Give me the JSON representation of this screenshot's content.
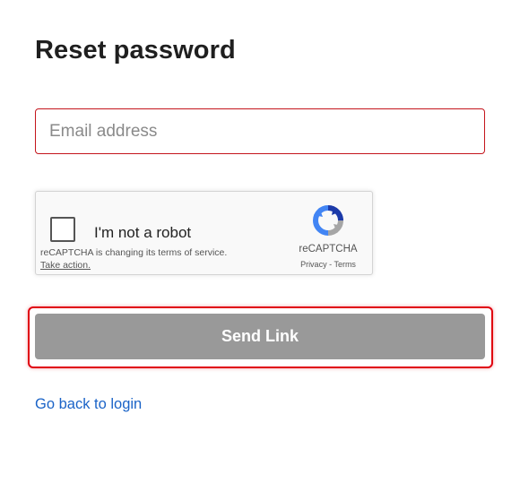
{
  "page": {
    "title": "Reset password"
  },
  "form": {
    "email_placeholder": "Email address",
    "email_value": "",
    "send_label": "Send Link",
    "back_link": "Go back to login"
  },
  "recaptcha": {
    "checkbox_label": "I'm not a robot",
    "notice": "reCAPTCHA is changing its terms of service.",
    "action": "Take action.",
    "brand": "reCAPTCHA",
    "privacy": "Privacy",
    "separator": "-",
    "terms": "Terms",
    "logo_icon": "recaptcha-logo-icon"
  },
  "colors": {
    "error_border": "#c4151c",
    "focus_outline": "#e0000f",
    "button_disabled": "#999999",
    "link": "#1a63c7"
  }
}
